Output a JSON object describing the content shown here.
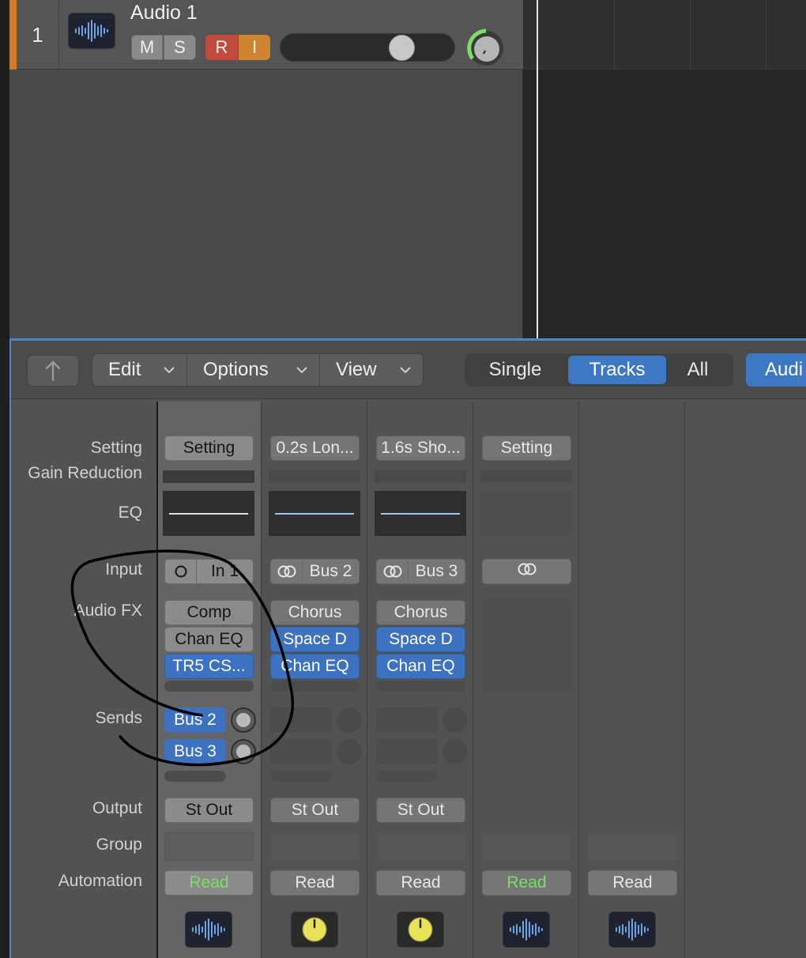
{
  "track": {
    "number": "1",
    "name": "Audio 1",
    "mute_label": "M",
    "solo_label": "S",
    "record_label": "R",
    "input_monitor_label": "I",
    "volume": 0.7,
    "icon": "waveform-icon"
  },
  "toolbar": {
    "back_icon": "back-arrow-icon",
    "menus": [
      {
        "label": "Edit"
      },
      {
        "label": "Options"
      },
      {
        "label": "View"
      }
    ],
    "view_modes": [
      {
        "label": "Single",
        "active": false
      },
      {
        "label": "Tracks",
        "active": true
      },
      {
        "label": "All",
        "active": false
      }
    ],
    "audio_tab_label": "Audi"
  },
  "row_labels": {
    "setting": "Setting",
    "gain_reduction": "Gain Reduction",
    "eq": "EQ",
    "input": "Input",
    "audio_fx": "Audio FX",
    "sends": "Sends",
    "output": "Output",
    "group": "Group",
    "automation": "Automation"
  },
  "strips": [
    {
      "setting": "Setting",
      "input_icon": "mono-circle-icon",
      "input": "In 1",
      "fx": [
        "Comp",
        "Chan EQ",
        "TR5 CS..."
      ],
      "sends": [
        "Bus 2",
        "Bus 3"
      ],
      "output": "St Out",
      "automation": "Read",
      "icon": "waveform-icon"
    },
    {
      "setting": "0.2s Lon...",
      "input_icon": "stereo-circles-icon",
      "input": "Bus 2",
      "fx": [
        "Chorus",
        "Space D",
        "Chan EQ"
      ],
      "output": "St Out",
      "automation": "Read",
      "icon": "yellow-knob-icon"
    },
    {
      "setting": "1.6s Sho...",
      "input_icon": "stereo-circles-icon",
      "input": "Bus 3",
      "fx": [
        "Chorus",
        "Space D",
        "Chan EQ"
      ],
      "output": "St Out",
      "automation": "Read",
      "icon": "yellow-knob-icon"
    },
    {
      "setting": "Setting",
      "input_icon": "stereo-circles-icon",
      "automation": "Read",
      "icon": "waveform-icon"
    },
    {
      "automation": "Read",
      "icon": "waveform-icon"
    }
  ],
  "colors": {
    "accent_blue": "#3d72c0",
    "read_green": "#7ddc6a",
    "record_red": "#c24a3e",
    "input_orange": "#cf8432",
    "track_color": "#d07a2b",
    "knob_yellow": "#e8e15a",
    "annotation": "#000000"
  }
}
